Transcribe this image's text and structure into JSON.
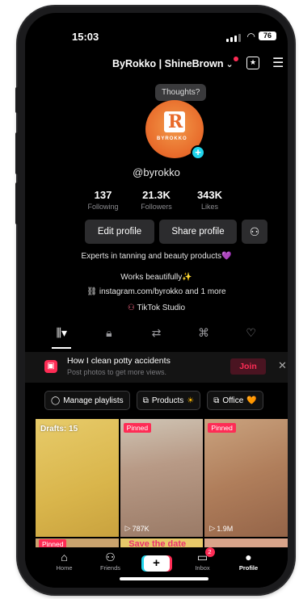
{
  "status": {
    "time": "15:03",
    "wifi": "wifi-icon",
    "battery": "76"
  },
  "header": {
    "account": "ByRokko | ShineBrown",
    "chevron": "⌄",
    "star_icon": "★",
    "menu_icon": "☰"
  },
  "profile": {
    "tooltip": "Thoughts?",
    "avatar_brand": "BYROKKO",
    "handle": "@byrokko",
    "stats": [
      {
        "num": "137",
        "label": "Following"
      },
      {
        "num": "21.3K",
        "label": "Followers"
      },
      {
        "num": "343K",
        "label": "Likes"
      }
    ],
    "edit_label": "Edit profile",
    "share_label": "Share profile",
    "bio_line1": "Experts in tanning and beauty products",
    "bio_heart": "💜",
    "bio_line2": "Works beautifully",
    "bio_sparkle": "✨",
    "link": "instagram.com/byrokko and 1 more",
    "studio": "TikTok Studio"
  },
  "promo": {
    "title": "How I clean potty accidents",
    "subtitle": "Post photos to get more views.",
    "join": "Join",
    "close": "✕"
  },
  "chips": {
    "playlists": "Manage playlists",
    "products": "Products",
    "products_emoji": "☀",
    "office": "Office",
    "office_emoji": "🧡"
  },
  "grid": {
    "drafts": "Drafts: 15",
    "pinned": "Pinned",
    "views_2": "787K",
    "views_3": "1.9M",
    "row2_text": "Save the date"
  },
  "nav": {
    "home": "Home",
    "friends": "Friends",
    "inbox": "Inbox",
    "inbox_badge": "2",
    "profile": "Profile"
  }
}
